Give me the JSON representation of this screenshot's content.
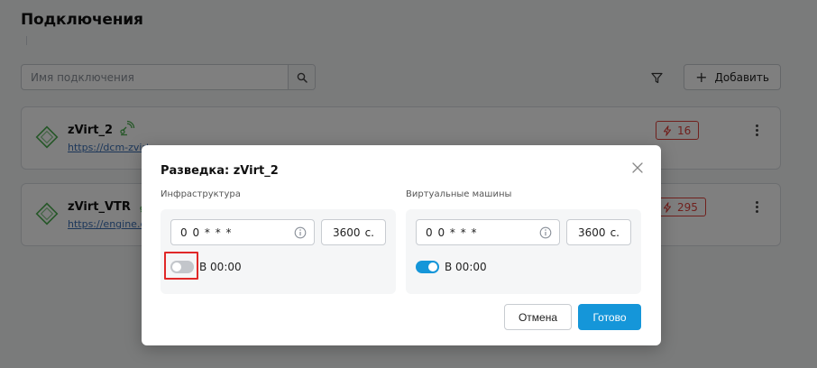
{
  "page": {
    "title": "Подключения",
    "search_placeholder": "Имя подключения",
    "add_label": "Добавить"
  },
  "connections": [
    {
      "name": "zVirt_2",
      "url": "https://dcm-zvirt-...",
      "alert_count": "16"
    },
    {
      "name": "zVirt_VTR",
      "url": "https://engine.c...",
      "alert_count": "295"
    }
  ],
  "modal": {
    "title": "Разведка: zVirt_2",
    "infrastructure": {
      "label": "Инфраструктура",
      "cron": "0 0 * * *",
      "interval_value": "3600",
      "interval_unit": "с.",
      "toggle_on": false,
      "toggle_label": "В 00:00"
    },
    "vms": {
      "label": "Виртуальные машины",
      "cron": "0 0 * * *",
      "interval_value": "3600",
      "interval_unit": "с.",
      "toggle_on": true,
      "toggle_label": "В 00:00"
    },
    "cancel_label": "Отмена",
    "done_label": "Готово"
  },
  "colors": {
    "accent": "#1596d9",
    "alert": "#e0413a",
    "logo": "#4caf50",
    "highlight": "#e02828"
  }
}
